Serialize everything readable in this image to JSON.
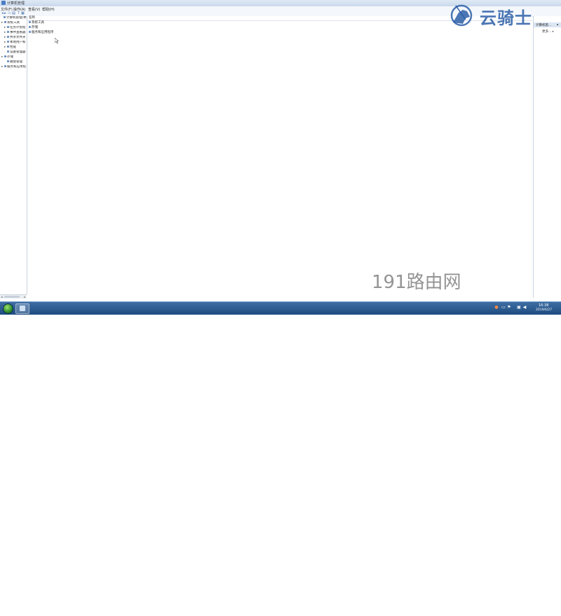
{
  "window": {
    "title": "计算机管理"
  },
  "menubar": {
    "items": [
      "文件(F)",
      "操作(A)",
      "查看(V)",
      "帮助(H)"
    ]
  },
  "tree": {
    "items": [
      {
        "label": "计算机管理(本",
        "expander": "",
        "indent": 0
      },
      {
        "label": "系统工具",
        "expander": "▸",
        "indent": 1
      },
      {
        "label": "任务计划程",
        "expander": "▸",
        "indent": 2
      },
      {
        "label": "事件查看器",
        "expander": "▸",
        "indent": 2
      },
      {
        "label": "共享文件夹",
        "expander": "▸",
        "indent": 2
      },
      {
        "label": "本地用户和",
        "expander": "▸",
        "indent": 2
      },
      {
        "label": "性能",
        "expander": "▸",
        "indent": 2
      },
      {
        "label": "设备管理器",
        "expander": "",
        "indent": 2
      },
      {
        "label": "存储",
        "expander": "▸",
        "indent": 1
      },
      {
        "label": "磁盘管理",
        "expander": "",
        "indent": 2
      },
      {
        "label": "服务和应用程",
        "expander": "▸",
        "indent": 1
      }
    ]
  },
  "list": {
    "column_header": "名称",
    "items": [
      "系统工具",
      "存储",
      "服务和应用程序"
    ]
  },
  "actions": {
    "header": "计算机管...",
    "more": "更多..."
  },
  "logo": {
    "text": "云骑士"
  },
  "watermark": {
    "text": "191路由网"
  },
  "taskbar": {
    "time": "16:38",
    "date": "2019/6/27"
  },
  "colors": {
    "logo": "#2d5fa8",
    "taskbar": "#2a5a90",
    "accent": "#6b8fbf"
  }
}
